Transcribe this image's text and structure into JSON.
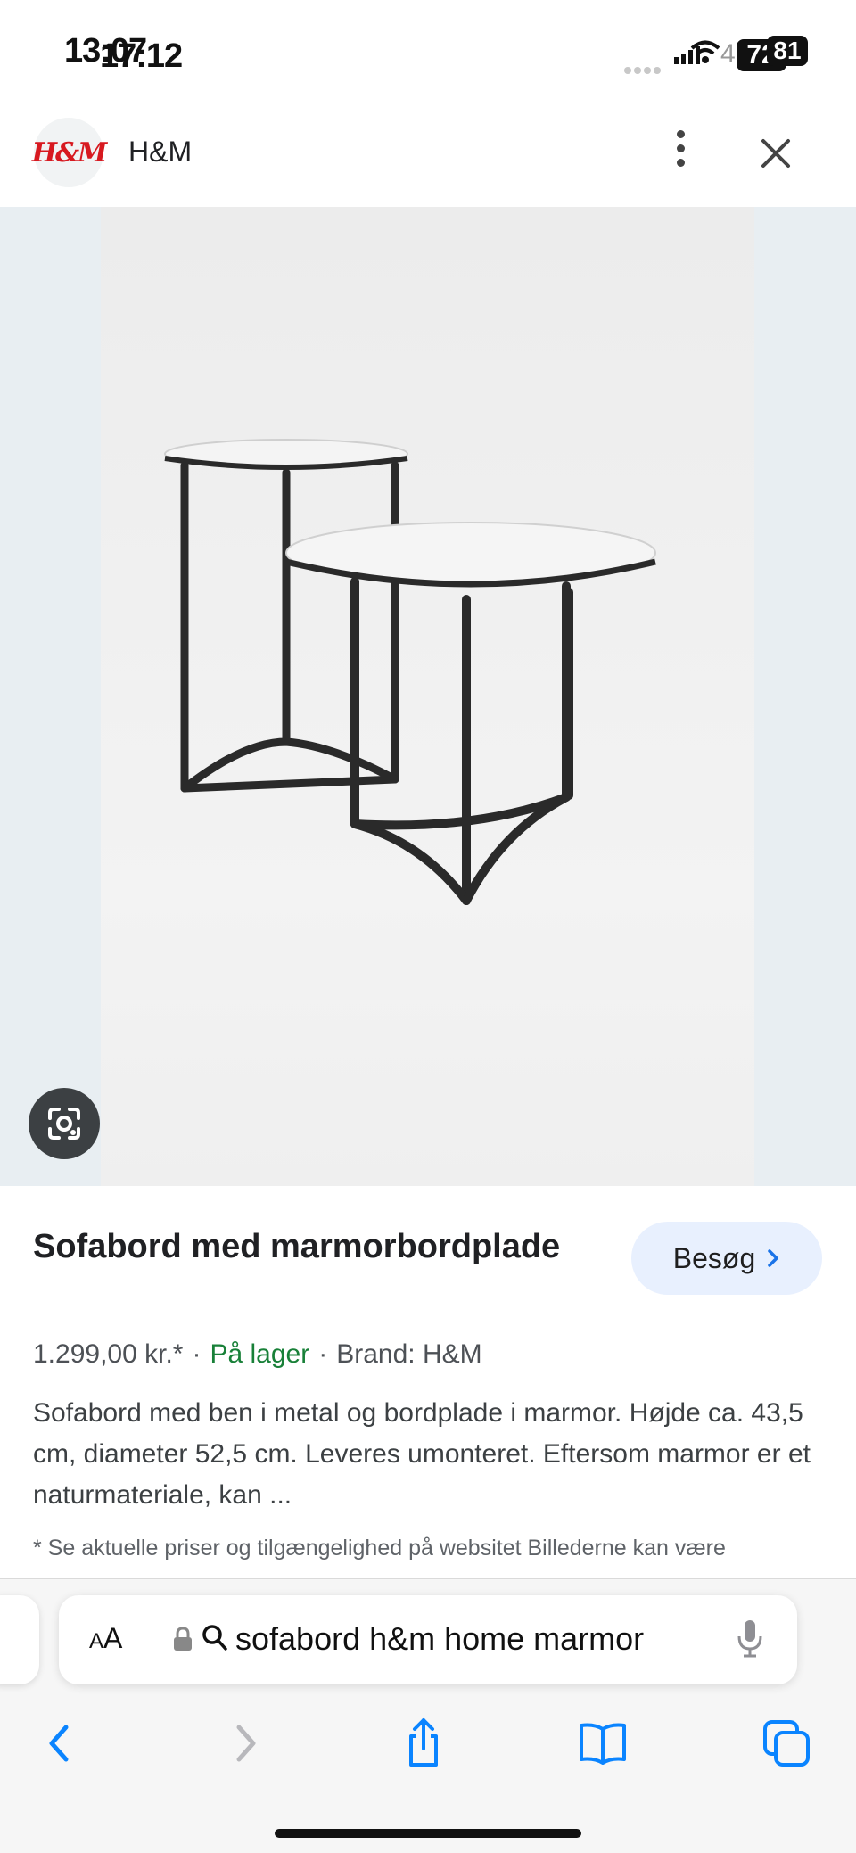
{
  "status_bar": {
    "time_overlap_a": "13:07",
    "time_overlap_b": "17:12",
    "carrier": "4",
    "battery_a": "72",
    "battery_b": "81"
  },
  "header": {
    "favicon_text": "H&M",
    "site_name": "H&M",
    "more_icon": "more-vert-icon",
    "close_icon": "close-icon"
  },
  "image": {
    "lens_icon": "google-lens-icon"
  },
  "product": {
    "title": "Sofabord med marmorbordplade",
    "visit_label": "Besøg",
    "price": "1.299,00 kr.*",
    "separator": "·",
    "stock": "På lager",
    "brand": "Brand: H&M",
    "description": "Sofabord med ben i metal og bordplade i marmor. Højde ca. 43,5 cm, diameter 52,5 cm. Leveres umonteret. Eftersom marmor er et naturmateriale, kan ...",
    "disclaimer": "* Se aktuelle priser og tilgængelighed på websitet Billederne kan være"
  },
  "browser": {
    "aa_label_small": "A",
    "aa_label_large": "A",
    "url": "sofabord h&m home marmor",
    "icons": [
      "lock-icon",
      "search-icon",
      "mic-icon",
      "back-icon",
      "forward-icon",
      "share-icon",
      "bookmarks-icon",
      "tabs-icon"
    ]
  },
  "colors": {
    "stock_green": "#188038",
    "visit_button_bg": "#e8f0fe",
    "brand_red": "#d71920",
    "ios_blue": "#0a84ff"
  }
}
